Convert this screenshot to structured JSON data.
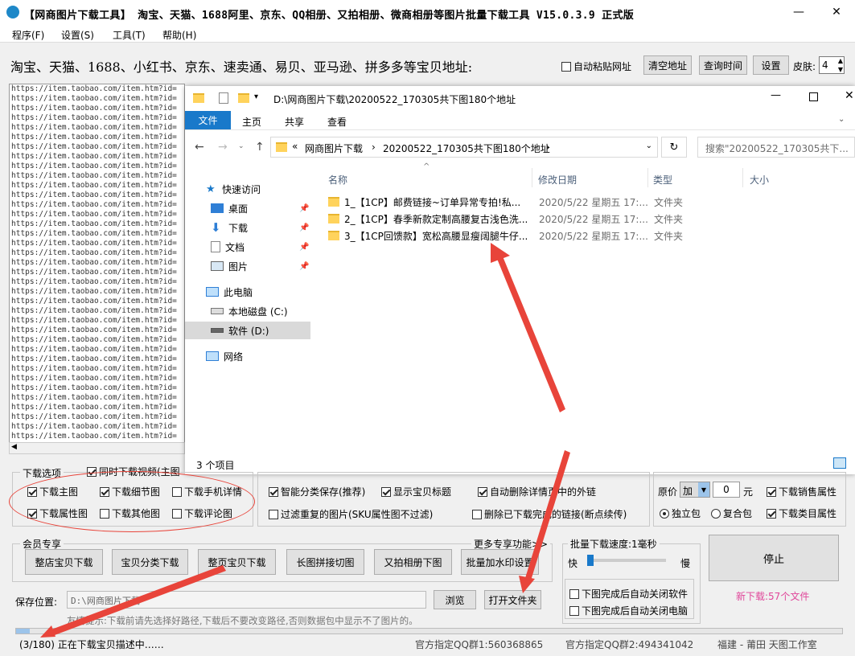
{
  "window": {
    "title": "【网商图片下载工具】 淘宝、天猫、1688阿里、京东、QQ相册、又拍相册、微商相册等图片批量下载工具 V15.0.3.9 正式版"
  },
  "menu": [
    "程序(F)",
    "设置(S)",
    "工具(T)",
    "帮助(H)"
  ],
  "toolbar": {
    "heading": "淘宝、天猫、1688、小红书、京东、速卖通、易贝、亚马逊、拼多多等宝贝地址:",
    "auto_paste": "自动粘贴网址",
    "clear_btn": "清空地址",
    "query_btn": "查询时间",
    "settings_btn": "设置",
    "skin_label": "皮肤:",
    "skin_value": "4"
  },
  "url_list_item": "https://item.taobao.com/item.htm?id=",
  "explorer": {
    "path_title": "D:\\网商图片下载\\20200522_170305共下图180个地址",
    "ribbon_tabs": [
      "文件",
      "主页",
      "共享",
      "查看"
    ],
    "breadcrumb_root": "网商图片下载",
    "breadcrumb_leaf": "20200522_170305共下图180个地址",
    "search_placeholder": "搜索\"20200522_170305共下...",
    "columns": {
      "name": "名称",
      "date": "修改日期",
      "type": "类型",
      "size": "大小"
    },
    "nav": {
      "quick": "快速访问",
      "desktop": "桌面",
      "downloads": "下载",
      "documents": "文档",
      "pictures": "图片",
      "pc": "此电脑",
      "c_drive": "本地磁盘 (C:)",
      "d_drive": "软件 (D:)",
      "network": "网络"
    },
    "files": [
      {
        "name": "1_【1CP】邮费链接~订单异常专拍!私...",
        "date": "2020/5/22 星期五 17:...",
        "type": "文件夹"
      },
      {
        "name": "2_【1CP】春季新款定制高腰复古浅色洗...",
        "date": "2020/5/22 星期五 17:...",
        "type": "文件夹"
      },
      {
        "name": "3_【1CP回馈款】宽松高腰显瘦阔腿牛仔...",
        "date": "2020/5/22 星期五 17:...",
        "type": "文件夹"
      }
    ],
    "item_count": "3 个项目"
  },
  "download_options": {
    "label": "下载选项",
    "items": [
      {
        "label": "同时下载视频(主图",
        "checked": true
      },
      {
        "label": "下载主图",
        "checked": true
      },
      {
        "label": "下载细节图",
        "checked": true
      },
      {
        "label": "下载手机详情",
        "checked": false
      },
      {
        "label": "下载属性图",
        "checked": true
      },
      {
        "label": "下载其他图",
        "checked": false
      },
      {
        "label": "下载评论图",
        "checked": false
      }
    ]
  },
  "func_options": {
    "items": [
      {
        "label": "智能分类保存(推荐)",
        "checked": true
      },
      {
        "label": "显示宝贝标题",
        "checked": true
      },
      {
        "label": "自动删除详情页中的外链",
        "checked": true
      },
      {
        "label": "过滤重复的图片(SKU属性图不过滤)",
        "checked": false
      },
      {
        "label": "删除已下载完成的链接(断点续传)",
        "checked": false
      }
    ]
  },
  "price_options": {
    "price_label": "原价",
    "price_op": "加",
    "price_value": "0",
    "unit": "元",
    "sales_attr": "下载销售属性",
    "standalone": "独立包",
    "combined": "复合包",
    "category_attr": "下载类目属性"
  },
  "member": {
    "label": "会员专享",
    "more": "更多专享功能>>",
    "buttons": [
      "整店宝贝下载",
      "宝贝分类下载",
      "整页宝贝下载",
      "长图拼接切图",
      "又拍相册下图",
      "批量加水印设置"
    ]
  },
  "speed": {
    "label": "批量下载速度:1毫秒",
    "fast": "快",
    "slow": "慢",
    "level": 0.02,
    "close_app": "下图完成后自动关闭软件",
    "shutdown": "下图完成后自动关闭电脑"
  },
  "stop_btn": "停止",
  "new_download": "新下载:57个文件",
  "save": {
    "label": "保存位置:",
    "path": "D:\\网商图片下载",
    "browse": "浏览",
    "open_folder": "打开文件夹",
    "tip": "友情提示:下载前请先选择好路径,下载后不要改变路径,否则数据包中显示不了图片的。"
  },
  "status": {
    "progress_text": "(3/180) 正在下载宝贝描述中……",
    "qq1": "官方指定QQ群1:560368865",
    "qq2": "官方指定QQ群2:494341042",
    "studio": "福建 - 莆田 天图工作室"
  }
}
